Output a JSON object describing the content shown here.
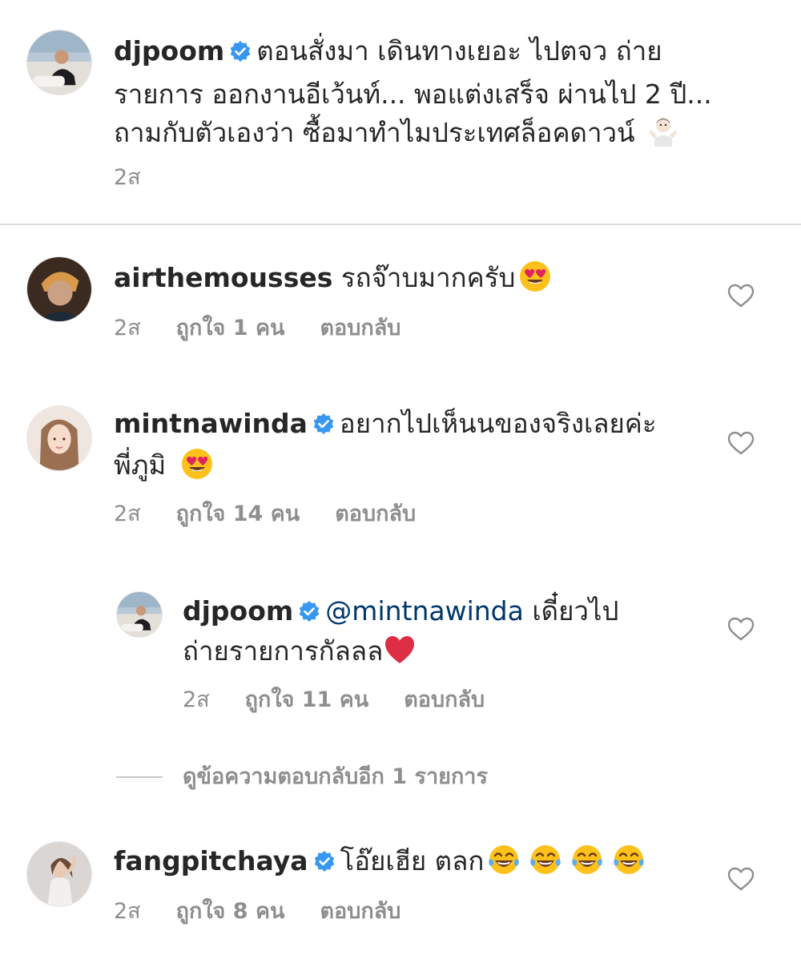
{
  "post": {
    "username": "djpoom",
    "caption_lines": [
      "ตอนสั่งมา เดินทางเยอะ ไปตจว ถ่าย",
      "รายการ ออกงานอีเว้นท์... พอแต่งเสร็จ ผ่านไป 2 ปี...",
      "ถามกับตัวเองว่า ซื้อมาทำไมประเทศล็อคดาวน์"
    ],
    "caption_emoji": "person-shrugging-emoji",
    "time": "2ส"
  },
  "comments": [
    {
      "username": "airthemousses",
      "text": "รถจ๊าบมากครับ",
      "emoji": "heart-eyes-emoji",
      "time": "2ส",
      "likes": "ถูกใจ 1 คน",
      "reply_label": "ตอบกลับ"
    },
    {
      "username": "mintnawinda",
      "text_line1": "อยากไปเห็นนของจริงเลยค่ะ",
      "text_line2": "พี่ภูมิ",
      "emoji": "heart-eyes-emoji",
      "time": "2ส",
      "likes": "ถูกใจ 14 คน",
      "reply_label": "ตอบกลับ"
    },
    {
      "username": "djpoom",
      "mention": "@mintnawinda",
      "text_line1": "เดี๋ยวไป",
      "text_line2": "ถ่ายรายการกัลลล",
      "emoji": "red-heart-emoji",
      "time": "2ส",
      "likes": "ถูกใจ 11 คน",
      "reply_label": "ตอบกลับ"
    },
    {
      "username": "fangpitchaya",
      "text": "โอ๊ยเฮีย ตลก",
      "emoji": "tears-of-joy-emoji",
      "time": "2ส",
      "likes": "ถูกใจ 8 คน",
      "reply_label": "ตอบกลับ"
    }
  ],
  "view_replies": "ดูข้อความตอบกลับอีก 1 รายการ",
  "colors": {
    "text": "#262626",
    "muted": "#8e8e8e",
    "verified": "#3897f0",
    "mention": "#00376b",
    "divider": "#dbdbdb"
  }
}
